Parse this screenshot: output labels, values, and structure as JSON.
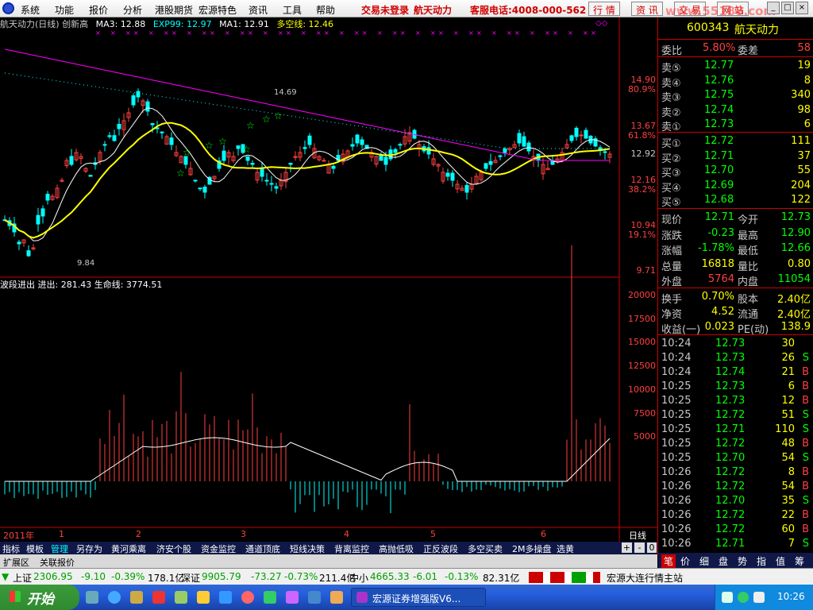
{
  "menu": {
    "items": [
      "系统",
      "功能",
      "报价",
      "分析",
      "港股期货",
      "宏源特色",
      "资讯",
      "工具",
      "帮助"
    ],
    "status": "交易未登录",
    "stock_name": "航天动力",
    "hotline": "客服电话:4008-000-562",
    "right_tabs": [
      "行 情",
      "资 讯",
      "交 易",
      "网 站"
    ],
    "watermark": "www.55188.com"
  },
  "chart_title": {
    "name": "航天动力(日线) 创新高",
    "ma3": "MA3: 12.88",
    "exp99": "EXP99: 12.97",
    "ma1": "MA1: 12.91",
    "duokong": "多空线: 12.46"
  },
  "price_axis": {
    "labels": [
      "14.90",
      "80.9%",
      "13.67",
      "61.8%",
      "12.92",
      "12.16",
      "38.2%",
      "10.94",
      "19.1%",
      "9.71"
    ],
    "colors": {
      "price": "#ff4040",
      "pct": "#ff4040",
      "ref": "#c8c8c8"
    }
  },
  "chart_annotations": {
    "high_mark": "14.69",
    "low_mark": "9.84"
  },
  "indicator": {
    "title": "波段进出",
    "jinchu": "进出: 281.43",
    "shengming": "生命线: 3774.51",
    "axis_labels": [
      "20000",
      "17500",
      "15000",
      "12500",
      "10000",
      "7500",
      "5000"
    ]
  },
  "time_axis": {
    "year_label": "2011年",
    "months": [
      "1",
      "2",
      "3",
      "4",
      "5",
      "6"
    ],
    "period": "日线"
  },
  "bottom_tabs": [
    "指标",
    "模板",
    "管理",
    "另存为",
    "黄河乘离",
    "济安个股",
    "资金监控",
    "通道顶底",
    "短线决策",
    "背离监控",
    "高抛低吸",
    "正反波段",
    "多空买卖",
    "2M多操盘",
    "选黄"
  ],
  "bottom_tab_controls": [
    "+",
    "-",
    "0"
  ],
  "ext_tabs": [
    "扩展区",
    "关联报价"
  ],
  "quote_panel": {
    "code": "600343",
    "name": "航天动力",
    "weibi_label": "委比",
    "weibi": "5.80%",
    "weicha_label": "委差",
    "weicha": "58",
    "sells": [
      {
        "label": "卖⑤",
        "price": "12.77",
        "vol": "19"
      },
      {
        "label": "卖④",
        "price": "12.76",
        "vol": "8"
      },
      {
        "label": "卖③",
        "price": "12.75",
        "vol": "340"
      },
      {
        "label": "卖②",
        "price": "12.74",
        "vol": "98"
      },
      {
        "label": "卖①",
        "price": "12.73",
        "vol": "6"
      }
    ],
    "buys": [
      {
        "label": "买①",
        "price": "12.72",
        "vol": "111"
      },
      {
        "label": "买②",
        "price": "12.71",
        "vol": "37"
      },
      {
        "label": "买③",
        "price": "12.70",
        "vol": "55"
      },
      {
        "label": "买④",
        "price": "12.69",
        "vol": "204"
      },
      {
        "label": "买⑤",
        "price": "12.68",
        "vol": "122"
      }
    ],
    "stats": [
      {
        "l1": "现价",
        "v1": "12.71",
        "c1": "#00ff00",
        "l2": "今开",
        "v2": "12.73",
        "c2": "#00ff00"
      },
      {
        "l1": "涨跌",
        "v1": "-0.23",
        "c1": "#00ff00",
        "l2": "最高",
        "v2": "12.90",
        "c2": "#00ff00"
      },
      {
        "l1": "涨幅",
        "v1": "-1.78%",
        "c1": "#00ff00",
        "l2": "最低",
        "v2": "12.66",
        "c2": "#00ff00"
      },
      {
        "l1": "总量",
        "v1": "16818",
        "c1": "#ffff00",
        "l2": "量比",
        "v2": "0.80",
        "c2": "#ffff00"
      },
      {
        "l1": "外盘",
        "v1": "5764",
        "c1": "#ff4040",
        "l2": "内盘",
        "v2": "11054",
        "c2": "#00ff00"
      }
    ],
    "stats2": [
      {
        "l1": "换手",
        "v1": "0.70%",
        "l2": "股本",
        "v2": "2.40亿"
      },
      {
        "l1": "净资",
        "v1": "4.52",
        "l2": "流通",
        "v2": "2.40亿"
      },
      {
        "l1": "收益(一)",
        "v1": "0.023",
        "l2": "PE(动)",
        "v2": "138.9"
      }
    ],
    "ticks": [
      {
        "t": "10:24",
        "p": "12.73",
        "v": "30",
        "s": ""
      },
      {
        "t": "10:24",
        "p": "12.73",
        "v": "26",
        "s": "S"
      },
      {
        "t": "10:24",
        "p": "12.74",
        "v": "21",
        "s": "B"
      },
      {
        "t": "10:25",
        "p": "12.73",
        "v": "6",
        "s": "B"
      },
      {
        "t": "10:25",
        "p": "12.73",
        "v": "12",
        "s": "B"
      },
      {
        "t": "10:25",
        "p": "12.72",
        "v": "51",
        "s": "S"
      },
      {
        "t": "10:25",
        "p": "12.71",
        "v": "110",
        "s": "S"
      },
      {
        "t": "10:25",
        "p": "12.72",
        "v": "48",
        "s": "B"
      },
      {
        "t": "10:25",
        "p": "12.70",
        "v": "54",
        "s": "S"
      },
      {
        "t": "10:26",
        "p": "12.72",
        "v": "8",
        "s": "B"
      },
      {
        "t": "10:26",
        "p": "12.72",
        "v": "54",
        "s": "B"
      },
      {
        "t": "10:26",
        "p": "12.70",
        "v": "35",
        "s": "S"
      },
      {
        "t": "10:26",
        "p": "12.72",
        "v": "22",
        "s": "B"
      },
      {
        "t": "10:26",
        "p": "12.72",
        "v": "60",
        "s": "B"
      },
      {
        "t": "10:26",
        "p": "12.71",
        "v": "7",
        "s": "S"
      }
    ],
    "bottom_tabs": [
      "笔",
      "价",
      "细",
      "盘",
      "势",
      "指",
      "值",
      "筹"
    ]
  },
  "ticker": {
    "items": [
      {
        "name": "上证",
        "val": "2306.95",
        "chg": "-9.10",
        "pct": "-0.39%",
        "amt": "178.1亿"
      },
      {
        "name": "深证",
        "val": "9905.79",
        "chg": "-73.27",
        "pct": "-0.73%",
        "amt": "211.4亿"
      },
      {
        "name": "中小",
        "val": "4665.33",
        "chg": "-6.01",
        "pct": "-0.13%",
        "amt": "82.31亿"
      }
    ],
    "right_label": "宏源大连行情主站"
  },
  "taskbar": {
    "start": "开始",
    "app": "宏源证券增强版V6...",
    "time": "10:26"
  }
}
